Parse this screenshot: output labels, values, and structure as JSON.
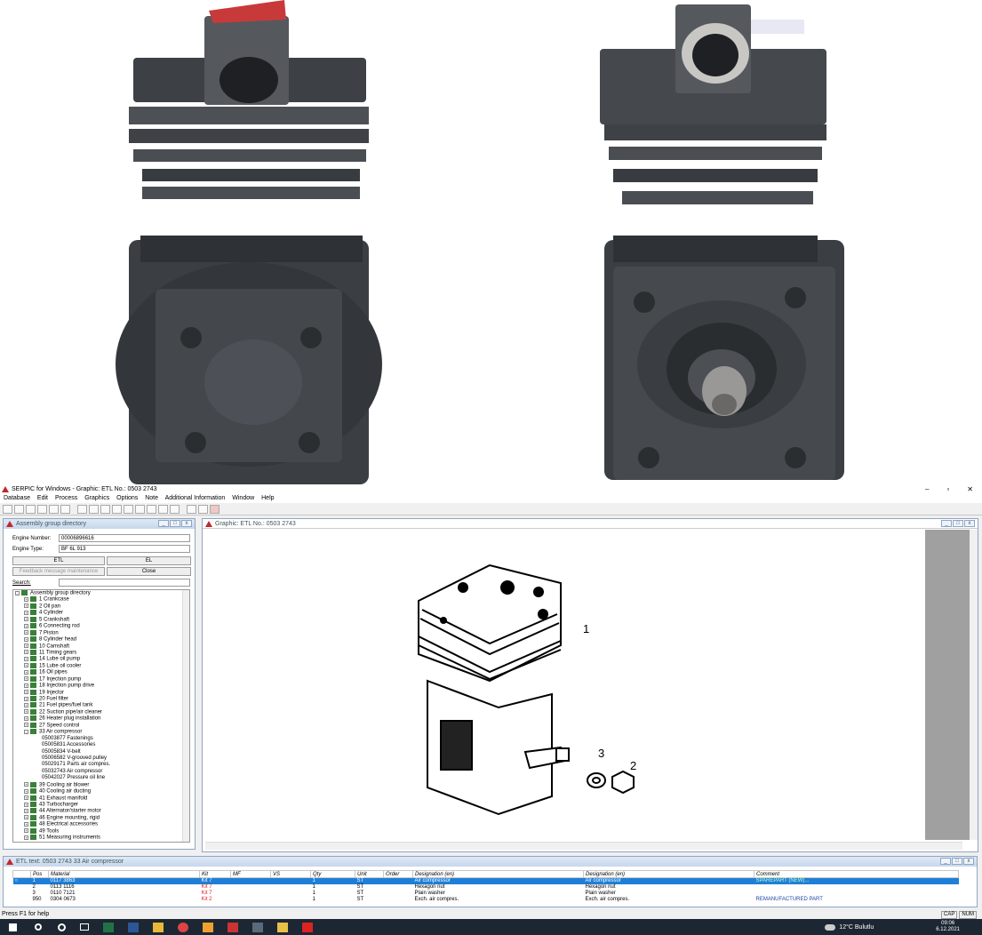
{
  "window": {
    "title": "SERPIC for Windows - Graphic: ETL No.: 0503 2743",
    "min": "–",
    "max": "▫",
    "close": "✕"
  },
  "menu": [
    "Database",
    "Edit",
    "Process",
    "Graphics",
    "Options",
    "Note",
    "Additional Information",
    "Window",
    "Help"
  ],
  "assembly": {
    "title": "Assembly group directory",
    "engine_number_label": "Engine Number:",
    "engine_number": "00006896616",
    "engine_type_label": "Engine Type:",
    "engine_type": "BF 6L 913",
    "etl_btn": "ETL",
    "el_btn": "EL",
    "feedback_btn": "Feedback message maintenance",
    "close_btn": "Close",
    "search_label": "Search:",
    "tree": [
      {
        "t": "root",
        "label": "Assembly group directory"
      },
      {
        "t": "node",
        "label": "1  Crankcase"
      },
      {
        "t": "node",
        "label": "2  Oil pan"
      },
      {
        "t": "node",
        "label": "4  Cylinder"
      },
      {
        "t": "node",
        "label": "5  Crankshaft"
      },
      {
        "t": "node",
        "label": "6  Connecting rod"
      },
      {
        "t": "node",
        "label": "7  Piston"
      },
      {
        "t": "node",
        "label": "8  Cylinder head"
      },
      {
        "t": "node",
        "label": "10  Camshaft"
      },
      {
        "t": "node",
        "label": "11  Timing gears"
      },
      {
        "t": "node",
        "label": "14  Lube oil pump"
      },
      {
        "t": "node",
        "label": "15  Lube oil cooler"
      },
      {
        "t": "node",
        "label": "16  Oil pipes"
      },
      {
        "t": "node",
        "label": "17  Injection pump"
      },
      {
        "t": "node",
        "label": "18  Injection pump drive"
      },
      {
        "t": "node",
        "label": "19  Injector"
      },
      {
        "t": "node",
        "label": "20  Fuel filter"
      },
      {
        "t": "node",
        "label": "21  Fuel pipes/fuel tank"
      },
      {
        "t": "node",
        "label": "22  Suction pipe/air cleaner"
      },
      {
        "t": "node",
        "label": "26  Heater plug installation"
      },
      {
        "t": "node",
        "label": "27  Speed control"
      },
      {
        "t": "open",
        "label": "33  Air compressor"
      },
      {
        "t": "leaf",
        "label": "05003877  Fastenings"
      },
      {
        "t": "leaf",
        "label": "05005831  Accessories"
      },
      {
        "t": "leaf",
        "label": "05005834  V-belt"
      },
      {
        "t": "leaf",
        "label": "05006582  V-grooved pulley"
      },
      {
        "t": "leaf",
        "label": "05029171  Parts air compres."
      },
      {
        "t": "leaf",
        "label": "05032743  Air compressor"
      },
      {
        "t": "leaf",
        "label": "05042027  Pressure oil line"
      },
      {
        "t": "node",
        "label": "39  Cooling air blower"
      },
      {
        "t": "node",
        "label": "40  Cooling air ducting"
      },
      {
        "t": "node",
        "label": "41  Exhaust manifold"
      },
      {
        "t": "node",
        "label": "43  Turbocharger"
      },
      {
        "t": "node",
        "label": "44  Alternator/starter motor"
      },
      {
        "t": "node",
        "label": "46  Engine mounting, rigid"
      },
      {
        "t": "node",
        "label": "48  Electrical accessories"
      },
      {
        "t": "node",
        "label": "49  Tools"
      },
      {
        "t": "node",
        "label": "51  Measuring instruments"
      }
    ]
  },
  "graphic": {
    "title": "Graphic: ETL No.: 0503 2743",
    "callouts": [
      "1",
      "3",
      "2"
    ]
  },
  "etl": {
    "title": "ETL text: 0503 2743    33   Air compressor",
    "headers": [
      "Pos",
      "Material",
      "Kit",
      "MF",
      "VS",
      "Qty",
      "Unit",
      "Order",
      "Designation (en)",
      "Designation (en)",
      "Comment"
    ],
    "rows": [
      {
        "pos": "1",
        "mat": "0117 3863",
        "kit": "Kit 7",
        "qty": "1",
        "unit": "ST",
        "d1": "Air compressor",
        "d2": "Air compressor",
        "comment": "SPAREPART (NEW)...",
        "sel": true
      },
      {
        "pos": "2",
        "mat": "0113 1116",
        "kit": "Kit 7",
        "qty": "1",
        "unit": "ST",
        "d1": "Hexagon nut",
        "d2": "Hexagon nut",
        "comment": ""
      },
      {
        "pos": "3",
        "mat": "0110 7121",
        "kit": "Kit 7",
        "qty": "1",
        "unit": "ST",
        "d1": "Plain washer",
        "d2": "Plain washer",
        "comment": ""
      },
      {
        "pos": "950",
        "mat": "0304 0673",
        "kit": "Kit 2",
        "qty": "1",
        "unit": "ST",
        "d1": "Exch. air compres.",
        "d2": "Exch. air compres.",
        "comment": "REMANUFACTURED PART"
      }
    ]
  },
  "status": {
    "text": "Press F1 for help",
    "cap": "CAP",
    "num": "NUM"
  },
  "taskbar": {
    "weather": "12°C  Bulutlu",
    "time": "09:06",
    "date": "6.12.2021"
  },
  "colors": {
    "panel_border": "#8fa6c4",
    "selection": "#1f7fd8",
    "taskbar": "#1c2733"
  }
}
